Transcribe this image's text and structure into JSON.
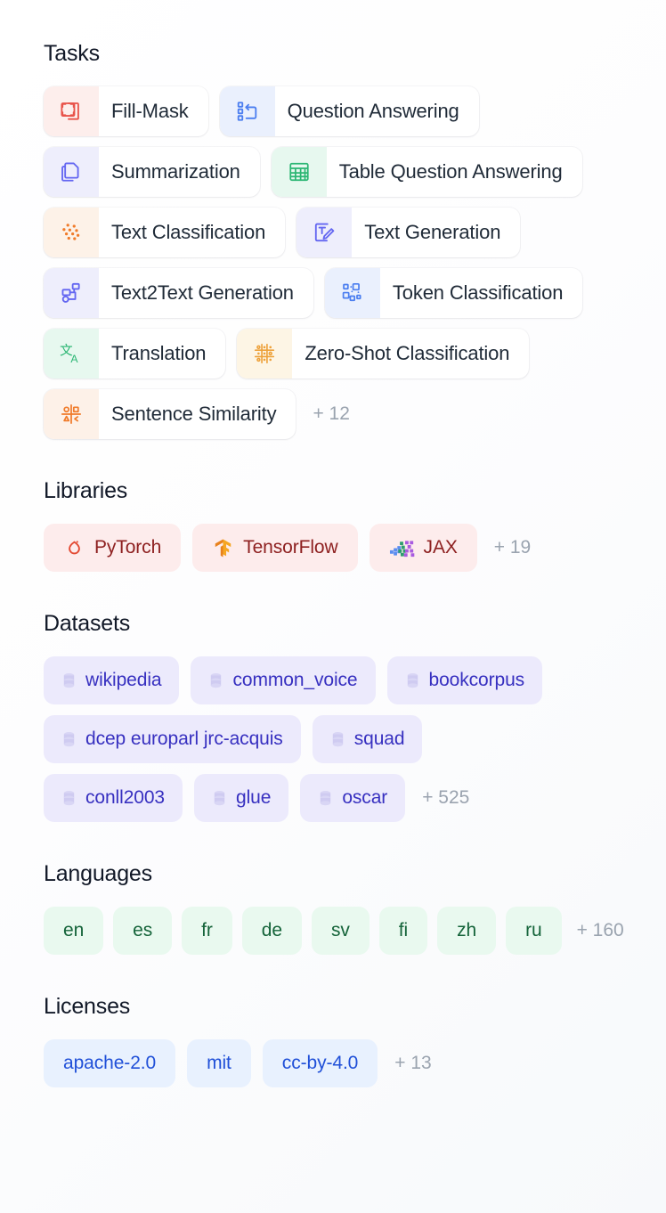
{
  "sections": [
    {
      "id": "tasks",
      "title": "Tasks",
      "more_label": "+ 12",
      "rows": [
        [
          {
            "label": "Fill-Mask",
            "icon": "fill-mask-icon",
            "icon_color": "#e8534a",
            "icon_bg": "#fdeeec"
          },
          {
            "label": "Question Answering",
            "icon": "question-answering-icon",
            "icon_color": "#4b7ef0",
            "icon_bg": "#eaf0fd"
          }
        ],
        [
          {
            "label": "Summarization",
            "icon": "summarization-icon",
            "icon_color": "#6366f1",
            "icon_bg": "#eeeefc"
          },
          {
            "label": "Table Question Answering",
            "icon": "table-question-answering-icon",
            "icon_color": "#2bb673",
            "icon_bg": "#e7f8ef"
          }
        ],
        [
          {
            "label": "Text Classification",
            "icon": "text-classification-icon",
            "icon_color": "#f07b2a",
            "icon_bg": "#fdf2e8"
          },
          {
            "label": "Text Generation",
            "icon": "text-generation-icon",
            "icon_color": "#6366f1",
            "icon_bg": "#eeeefc"
          }
        ],
        [
          {
            "label": "Text2Text Generation",
            "icon": "text2text-generation-icon",
            "icon_color": "#6366f1",
            "icon_bg": "#eeeefc"
          },
          {
            "label": "Token Classification",
            "icon": "token-classification-icon",
            "icon_color": "#4b7ef0",
            "icon_bg": "#eaf0fd"
          }
        ],
        [
          {
            "label": "Translation",
            "icon": "translation-icon",
            "icon_color": "#2bb673",
            "icon_bg": "#e7f8ef"
          },
          {
            "label": "Zero-Shot Classification",
            "icon": "zero-shot-classification-icon",
            "icon_color": "#eda13a",
            "icon_bg": "#fdf5e5"
          }
        ],
        [
          {
            "label": "Sentence Similarity",
            "icon": "sentence-similarity-icon",
            "icon_color": "#f07b2a",
            "icon_bg": "#fdf1e8"
          }
        ]
      ]
    },
    {
      "id": "libraries",
      "title": "Libraries",
      "more_label": "+ 19",
      "items": [
        {
          "label": "PyTorch",
          "icon": "pytorch-icon"
        },
        {
          "label": "TensorFlow",
          "icon": "tensorflow-icon"
        },
        {
          "label": "JAX",
          "icon": "jax-icon"
        }
      ]
    },
    {
      "id": "datasets",
      "title": "Datasets",
      "more_label": "+ 525",
      "rows": [
        [
          {
            "label": "wikipedia",
            "icon": "database-icon"
          },
          {
            "label": "common_voice",
            "icon": "database-icon"
          },
          {
            "label": "bookcorpus",
            "icon": "database-icon"
          }
        ],
        [
          {
            "label": "dcep europarl jrc-acquis",
            "icon": "database-icon"
          },
          {
            "label": "squad",
            "icon": "database-icon"
          }
        ],
        [
          {
            "label": "conll2003",
            "icon": "database-icon"
          },
          {
            "label": "glue",
            "icon": "database-icon"
          },
          {
            "label": "oscar",
            "icon": "database-icon"
          }
        ]
      ]
    },
    {
      "id": "languages",
      "title": "Languages",
      "more_label": "+ 160",
      "items": [
        {
          "label": "en"
        },
        {
          "label": "es"
        },
        {
          "label": "fr"
        },
        {
          "label": "de"
        },
        {
          "label": "sv"
        },
        {
          "label": "fi"
        },
        {
          "label": "zh"
        },
        {
          "label": "ru"
        }
      ]
    },
    {
      "id": "licenses",
      "title": "Licenses",
      "more_label": "+ 13",
      "items": [
        {
          "label": "apache-2.0"
        },
        {
          "label": "mit"
        },
        {
          "label": "cc-by-4.0"
        }
      ]
    }
  ],
  "colors": {
    "task_tag_bg": "#ffffff",
    "task_text": "#1f2a37",
    "library_bg": "#fdecec",
    "library_text": "#8e2020",
    "dataset_bg": "#eceafc",
    "dataset_text": "#3730c0",
    "language_bg": "#e9f9ef",
    "language_text": "#15643a",
    "license_bg": "#e8f1fe",
    "license_text": "#2050d8",
    "more_text": "#9aa3af",
    "section_title": "#111827"
  }
}
